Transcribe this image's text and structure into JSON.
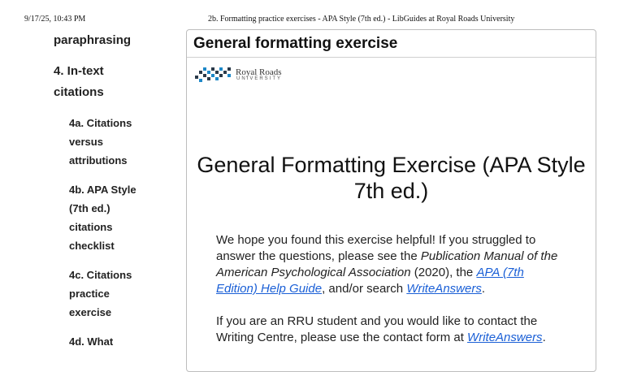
{
  "print_header": {
    "date": "9/17/25, 10:43 PM",
    "title": "2b. Formatting practice exercises - APA Style (7th ed.) - LibGuides at Royal Roads University"
  },
  "sidebar": {
    "items": [
      {
        "label": "paraphrasing"
      },
      {
        "label": "4. In-text"
      },
      {
        "label": "citations"
      },
      {
        "label": "4a. Citations"
      },
      {
        "label": "versus"
      },
      {
        "label": "attributions"
      },
      {
        "label": "4b. APA Style"
      },
      {
        "label": "(7th ed.)"
      },
      {
        "label": "citations"
      },
      {
        "label": "checklist"
      },
      {
        "label": "4c. Citations"
      },
      {
        "label": "practice"
      },
      {
        "label": "exercise"
      },
      {
        "label": "4d. What"
      }
    ]
  },
  "panel": {
    "heading": "General formatting exercise",
    "logo": {
      "name": "Royal Roads",
      "sub": "UNIVERSITY"
    },
    "exercise_title": "General Formatting Exercise (APA Style 7th ed.)",
    "para1": {
      "t1": "We hope you found this exercise helpful! If you struggled to answer the questions, please see the ",
      "em": "Publication Manual of the American Psychological Association",
      "t2": " (2020), the ",
      "link1": "APA (7th Edition) Help Guide",
      "t3": ", and/or search ",
      "link2": "WriteAnswers",
      "t4": "."
    },
    "para2": {
      "t1": "If you are an RRU student and you would like to contact the Writing Centre, please use the contact form at ",
      "link": "WriteAnswers",
      "t2": "."
    }
  },
  "colors": {
    "link": "#1a5fd6",
    "border": "#bdbdbd",
    "logo_blue": "#1e88c8",
    "logo_dark": "#2a3a4a"
  }
}
